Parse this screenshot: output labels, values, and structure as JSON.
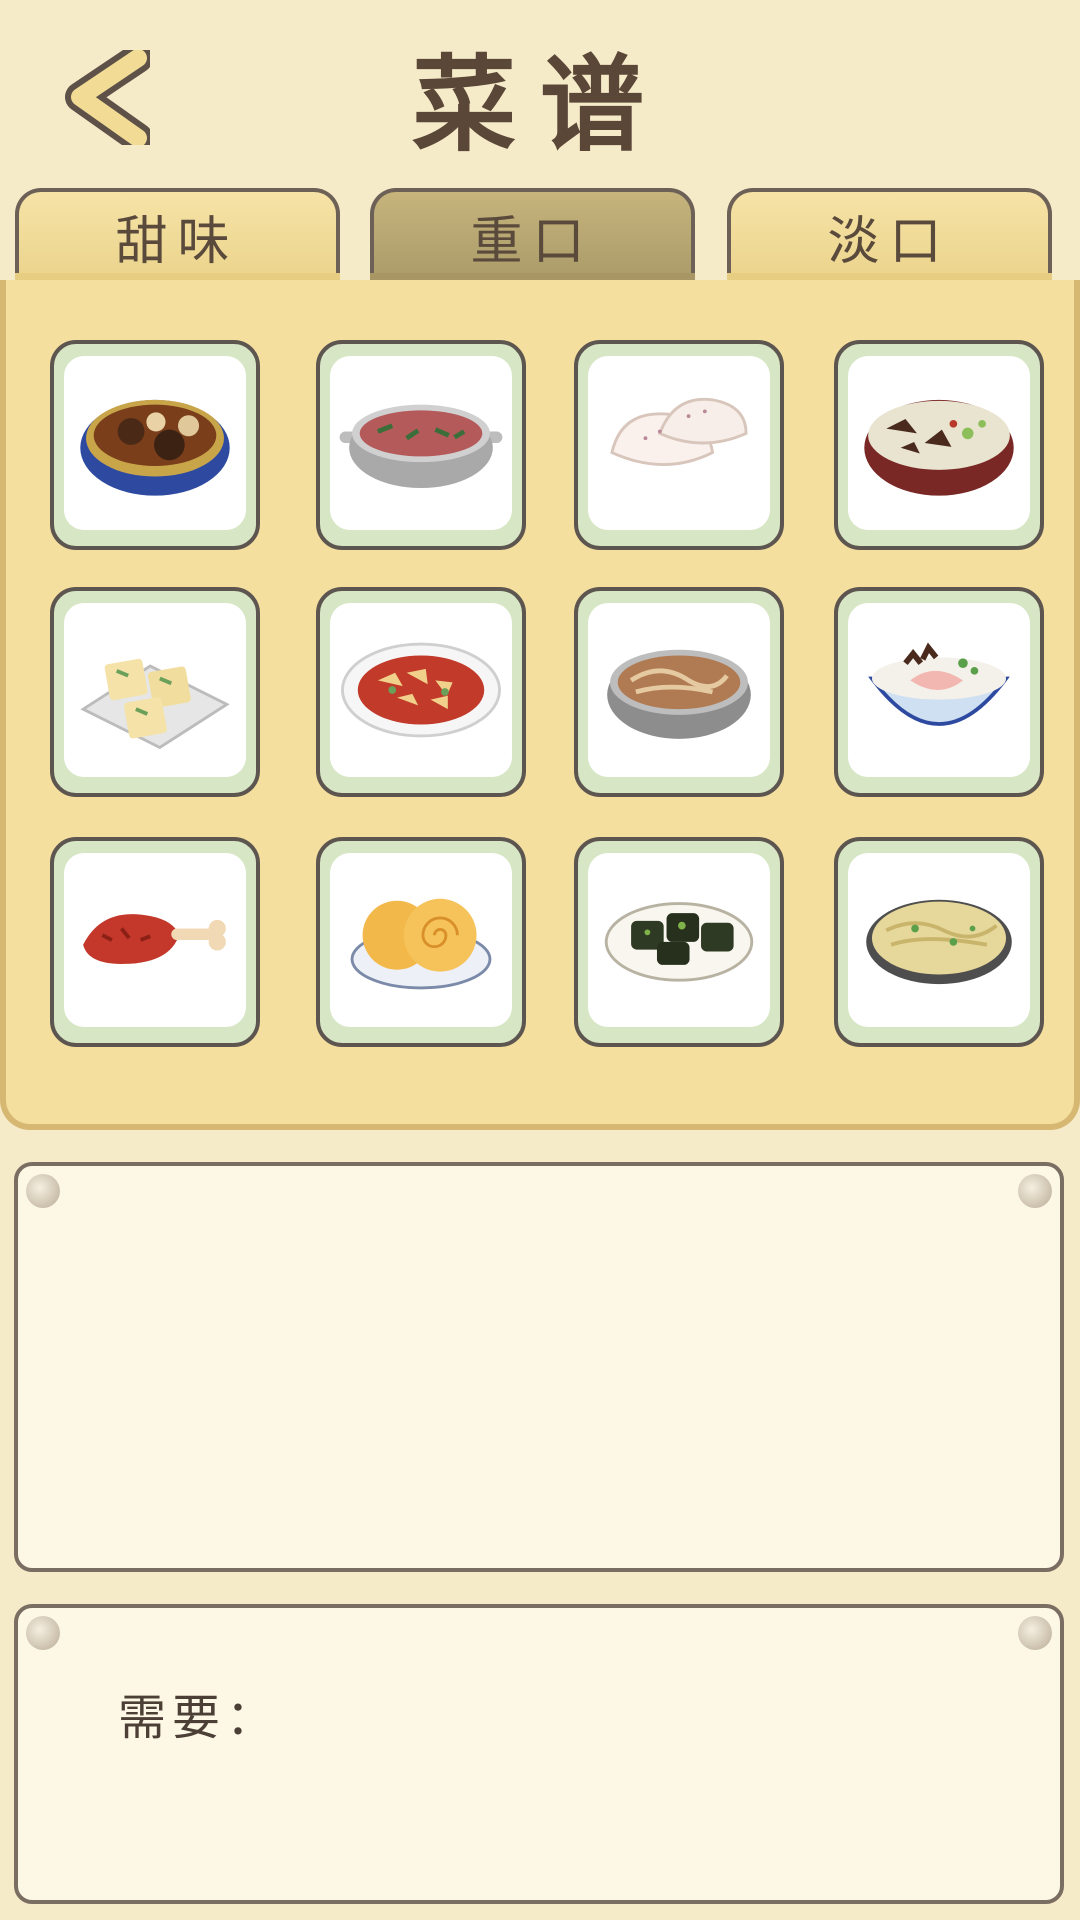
{
  "header": {
    "title": "菜谱",
    "back_icon": "chevron-left-icon"
  },
  "tabs": [
    {
      "label": "甜味",
      "active": false
    },
    {
      "label": "重口",
      "active": true
    },
    {
      "label": "淡口",
      "active": false
    }
  ],
  "recipes": [
    {
      "icon": "mushroom-braise-bowl-icon"
    },
    {
      "icon": "meat-pot-icon"
    },
    {
      "icon": "dumplings-icon"
    },
    {
      "icon": "mushroom-soup-bowl-icon"
    },
    {
      "icon": "tofu-plate-icon"
    },
    {
      "icon": "fried-chunks-plate-icon"
    },
    {
      "icon": "noodle-pot-icon"
    },
    {
      "icon": "meat-rice-bowl-icon"
    },
    {
      "icon": "chicken-drumstick-icon"
    },
    {
      "icon": "pastry-buns-icon"
    },
    {
      "icon": "dark-tofu-plate-icon"
    },
    {
      "icon": "noodle-pan-icon"
    }
  ],
  "description": {
    "text": ""
  },
  "requirements": {
    "label": "需要："
  },
  "colors": {
    "background": "#f6ebc9",
    "panel": "#f4df9f",
    "tab_active": "#a99a68",
    "card_frame": "#d7e6c4"
  }
}
